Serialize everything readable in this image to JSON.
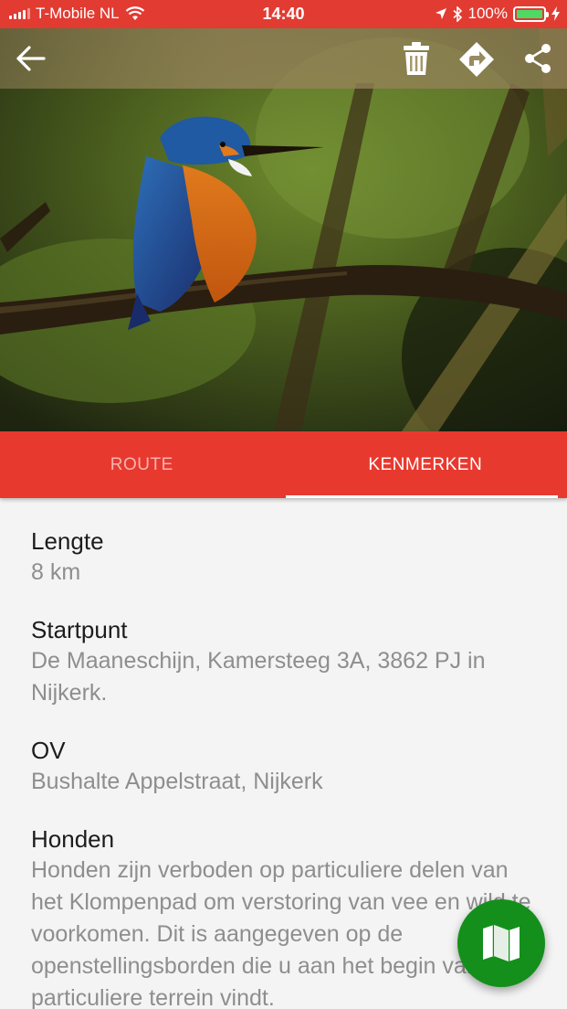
{
  "status_bar": {
    "carrier": "T-Mobile NL",
    "time": "14:40",
    "battery_percent": "100%",
    "battery_level": 1.0
  },
  "toolbar": {
    "back_icon": "arrow-left-icon",
    "delete_icon": "trash-icon",
    "directions_icon": "directions-icon",
    "share_icon": "share-icon"
  },
  "tabs": [
    {
      "label": "ROUTE",
      "active": false
    },
    {
      "label": "KENMERKEN",
      "active": true
    }
  ],
  "details": [
    {
      "label": "Lengte",
      "value": "8 km"
    },
    {
      "label": "Startpunt",
      "value": "De Maaneschijn, Kamersteeg 3A, 3862 PJ in Nijkerk."
    },
    {
      "label": "OV",
      "value": "Bushalte Appelstraat, Nijkerk"
    },
    {
      "label": "Honden",
      "value": "Honden zijn verboden op particuliere delen van het Klompenpad om verstoring van vee en wild te voorkomen. Dit is aangegeven op de openstellingsborden die u aan het begin van het particuliere terrein vindt."
    }
  ],
  "fab": {
    "icon": "map-icon"
  },
  "colors": {
    "brand_red": "#e8392f",
    "fab_green": "#148f1c"
  }
}
